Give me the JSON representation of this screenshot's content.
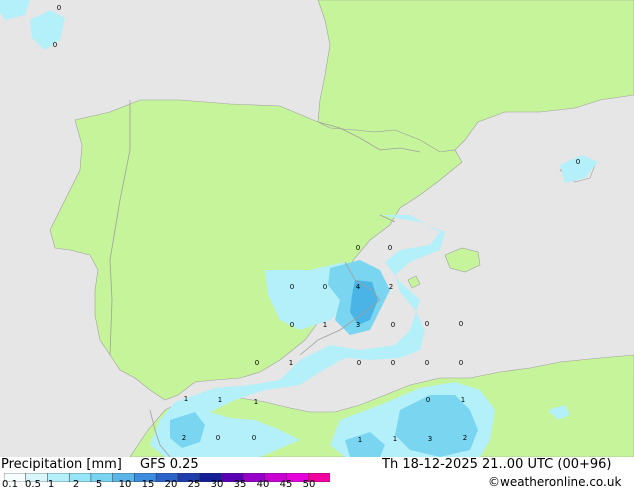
{
  "map": {
    "colors": {
      "sea": "#e6e6e6",
      "land": "#c6f49a",
      "border": "#a0a0a0",
      "precip_light": "#b4f0fa",
      "precip_medium": "#7ad6f0",
      "precip_heavy": "#4ab4e6"
    },
    "precip_values": [
      "0",
      "0",
      "0",
      "0",
      "0",
      "4",
      "2",
      "0",
      "1",
      "3",
      "0",
      "0",
      "0",
      "0",
      "1",
      "0",
      "0",
      "0",
      "0",
      "1",
      "1",
      "1",
      "2",
      "0",
      "0",
      "0",
      "1",
      "1",
      "1",
      "3",
      "2",
      "0",
      "0"
    ]
  },
  "legend": {
    "title": "Precipitation [mm]",
    "model": "GFS 0.25",
    "datetime": "Th 18-12-2025 21..00 UTC (00+96)",
    "credit": "©weatheronline.co.uk",
    "scale_labels": [
      "0.1",
      "0.5",
      "1",
      "2",
      "5",
      "10",
      "15",
      "20",
      "25",
      "30",
      "35",
      "40",
      "45",
      "50"
    ],
    "scale_colors": [
      "#f5fdfe",
      "#d8f6fb",
      "#b4f0fa",
      "#96e6f8",
      "#78d4f0",
      "#5ab4e6",
      "#3c8ce0",
      "#2a64c8",
      "#1e3caa",
      "#141e96",
      "#5a00b4",
      "#9600c8",
      "#c800d2",
      "#e600dc",
      "#f000a0"
    ]
  }
}
